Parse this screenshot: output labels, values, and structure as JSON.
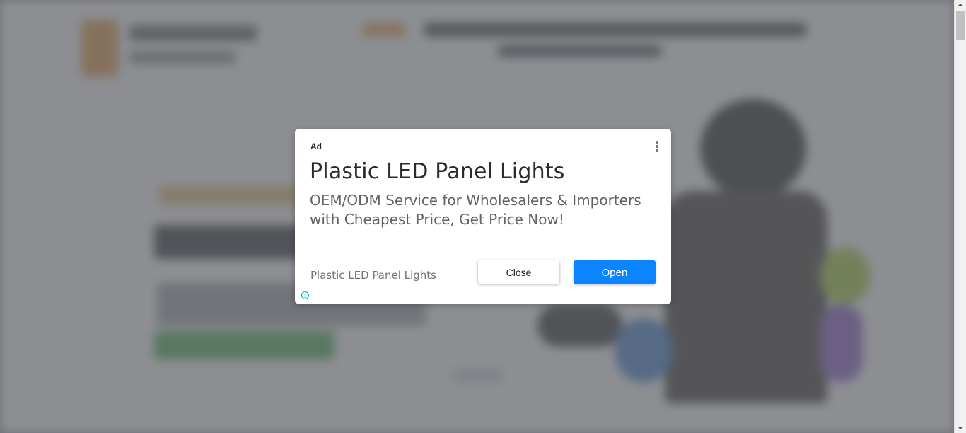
{
  "ad": {
    "label": "Ad",
    "title": "Plastic LED Panel Lights",
    "description": "OEM/ODM Service for Wholesalers & Importers with Cheapest Price, Get Price Now!",
    "advertiser": "Plastic LED Panel Lights",
    "close_label": "Close",
    "open_label": "Open",
    "menu_icon": "more-vert-icon",
    "info_icon": "info-icon",
    "info_glyph": "i"
  },
  "colors": {
    "open_button": "#0a84ff",
    "overlay": "#5f6368",
    "info_icon": "#00aecd"
  }
}
